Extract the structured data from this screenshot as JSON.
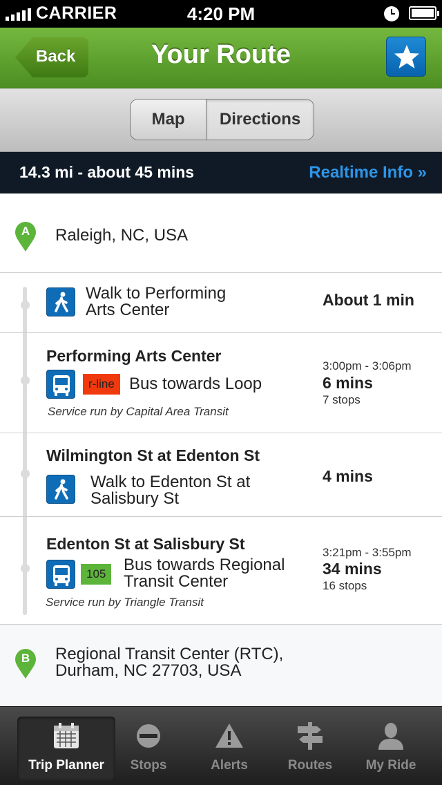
{
  "status_bar": {
    "carrier": "CARRIER",
    "time": "4:20 PM"
  },
  "nav": {
    "back_label": "Back",
    "title": "Your Route",
    "favorite_icon": "star-icon"
  },
  "segmented": {
    "map": "Map",
    "directions": "Directions",
    "selected": "Directions"
  },
  "summary": {
    "text": "14.3 mi - about 45 mins",
    "realtime_label": "Realtime Info »"
  },
  "origin": {
    "marker": "A",
    "address": "Raleigh, NC, USA"
  },
  "steps": [
    {
      "mode": "walk",
      "description_line1": "Walk to Performing",
      "description_line2": "Arts Center",
      "duration": "About 1 min"
    },
    {
      "mode": "bus",
      "stop": "Performing Arts Center",
      "route": "r-line",
      "route_color": "#f03a0e",
      "description": "Bus towards Loop",
      "service": "Service run by Capital Area Transit",
      "time_range": "3:00pm - 3:06pm",
      "duration": "6 mins",
      "stops": "7 stops"
    },
    {
      "mode": "walk",
      "stop": "Wilmington St at Edenton St",
      "description_line1": "Walk to Edenton St at",
      "description_line2": "Salisbury St",
      "duration": "4 mins"
    },
    {
      "mode": "bus",
      "stop": "Edenton St at Salisbury St",
      "route": "105",
      "route_color": "#5cb53a",
      "description_line1": "Bus towards Regional",
      "description_line2": "Transit Center",
      "service": "Service run by Triangle Transit",
      "time_range": "3:21pm - 3:55pm",
      "duration": "34 mins",
      "stops": "16 stops"
    }
  ],
  "destination": {
    "marker": "B",
    "address_line1": "Regional Transit Center (RTC),",
    "address_line2": "Durham, NC 27703, USA"
  },
  "tabs": [
    {
      "label": "Trip Planner",
      "icon": "calendar-icon",
      "active": true
    },
    {
      "label": "Stops",
      "icon": "stop-sign-icon",
      "active": false
    },
    {
      "label": "Alerts",
      "icon": "warning-icon",
      "active": false
    },
    {
      "label": "Routes",
      "icon": "signpost-icon",
      "active": false
    },
    {
      "label": "My Ride",
      "icon": "person-icon",
      "active": false
    }
  ],
  "colors": {
    "nav_green": "#5ea22e",
    "accent_blue": "#0f6db7",
    "link_blue": "#2d95e8",
    "pin_green": "#5cb53a"
  }
}
